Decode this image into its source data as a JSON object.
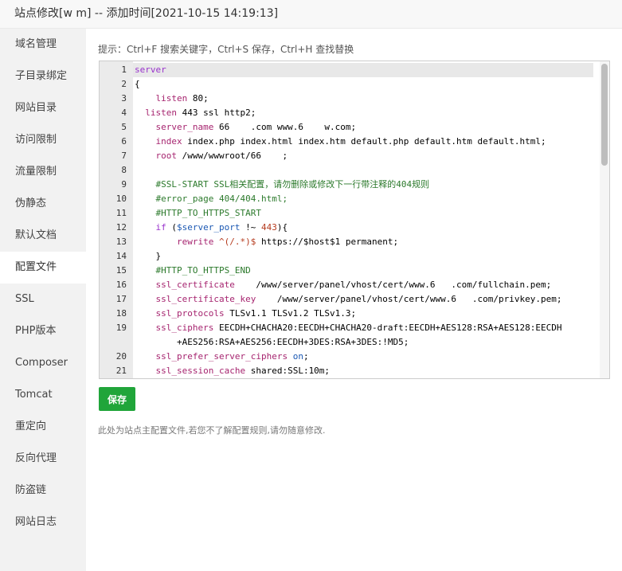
{
  "window": {
    "title": "站点修改[w            m] -- 添加时间[2021-10-15 14:19:13]"
  },
  "sidebar": {
    "items": [
      {
        "label": "域名管理"
      },
      {
        "label": "子目录绑定"
      },
      {
        "label": "网站目录"
      },
      {
        "label": "访问限制"
      },
      {
        "label": "流量限制"
      },
      {
        "label": "伪静态"
      },
      {
        "label": "默认文档"
      },
      {
        "label": "配置文件",
        "active": true
      },
      {
        "label": "SSL"
      },
      {
        "label": "PHP版本"
      },
      {
        "label": "Composer"
      },
      {
        "label": "Tomcat"
      },
      {
        "label": "重定向"
      },
      {
        "label": "反向代理"
      },
      {
        "label": "防盗链"
      },
      {
        "label": "网站日志"
      }
    ]
  },
  "main": {
    "hint": "提示：Ctrl+F 搜索关键字，Ctrl+S 保存，Ctrl+H 查找替换",
    "save_label": "保存",
    "note": "此处为站点主配置文件,若您不了解配置规则,请勿随意修改."
  },
  "editor": {
    "lines": [
      {
        "n": "1",
        "text": "server",
        "active": true
      },
      {
        "n": "2",
        "text": "{"
      },
      {
        "n": "3",
        "text": "    listen 80;"
      },
      {
        "n": "4",
        "text": "  listen 443 ssl http2;"
      },
      {
        "n": "5",
        "text": "    server_name 66    .com www.6    w.com;"
      },
      {
        "n": "6",
        "text": "    index index.php index.html index.htm default.php default.htm default.html;"
      },
      {
        "n": "7",
        "text": "    root /www/wwwroot/66    ;"
      },
      {
        "n": "8",
        "text": ""
      },
      {
        "n": "9",
        "text": "    #SSL-START SSL相关配置，请勿删除或修改下一行带注释的404规则"
      },
      {
        "n": "10",
        "text": "    #error_page 404/404.html;"
      },
      {
        "n": "11",
        "text": "    #HTTP_TO_HTTPS_START"
      },
      {
        "n": "12",
        "text": "    if ($server_port !~ 443){"
      },
      {
        "n": "13",
        "text": "        rewrite ^(/.*)$ https://$host$1 permanent;"
      },
      {
        "n": "14",
        "text": "    }"
      },
      {
        "n": "15",
        "text": "    #HTTP_TO_HTTPS_END"
      },
      {
        "n": "16",
        "text": "    ssl_certificate    /www/server/panel/vhost/cert/www.6   .com/fullchain.pem;"
      },
      {
        "n": "17",
        "text": "    ssl_certificate_key    /www/server/panel/vhost/cert/www.6   .com/privkey.pem;"
      },
      {
        "n": "18",
        "text": "    ssl_protocols TLSv1.1 TLSv1.2 TLSv1.3;"
      },
      {
        "n": "19",
        "text": "    ssl_ciphers EECDH+CHACHA20:EECDH+CHACHA20-draft:EECDH+AES128:RSA+AES128:EECDH"
      },
      {
        "n": "",
        "text": "        +AES256:RSA+AES256:EECDH+3DES:RSA+3DES:!MD5;"
      },
      {
        "n": "20",
        "text": "    ssl_prefer_server_ciphers on;"
      },
      {
        "n": "21",
        "text": "    ssl_session_cache shared:SSL:10m;"
      }
    ]
  },
  "colors": {
    "accent": "#20a53a",
    "comment": "#2c7a2c",
    "keyword": "#9932cc",
    "variable": "#1b58b3",
    "directive": "#a6246f"
  }
}
